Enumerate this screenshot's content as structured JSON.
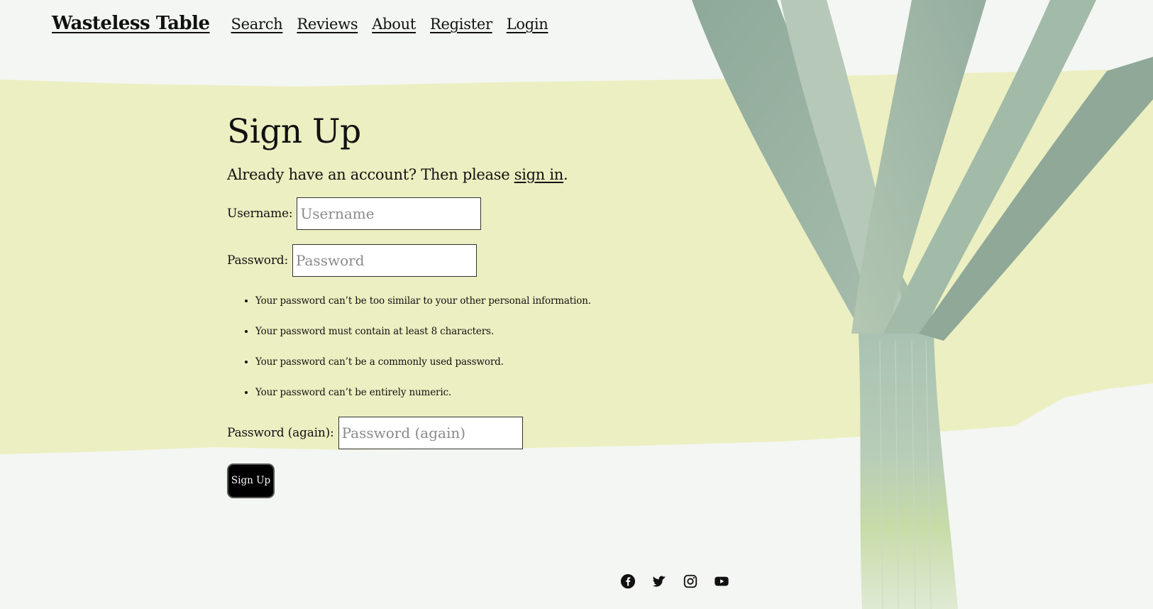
{
  "nav": {
    "brand": "Wasteless Table",
    "links": [
      "Search",
      "Reviews",
      "About",
      "Register",
      "Login"
    ]
  },
  "page": {
    "title": "Sign Up",
    "lead_prefix": "Already have an account? Then please ",
    "lead_link": "sign in",
    "lead_suffix": "."
  },
  "form": {
    "username_label": "Username:",
    "username_placeholder": "Username",
    "password_label": "Password:",
    "password_placeholder": "Password",
    "help": [
      "Your password can’t be too similar to your other personal information.",
      "Your password must contain at least 8 characters.",
      "Your password can’t be a commonly used password.",
      "Your password can’t be entirely numeric."
    ],
    "password2_label": "Password (again):",
    "password2_placeholder": "Password (again)",
    "submit_label": "Sign Up"
  },
  "footer": {
    "social_icons": [
      "facebook-icon",
      "twitter-icon",
      "instagram-icon",
      "youtube-icon"
    ]
  },
  "colors": {
    "paint_stroke": "#ecefc1",
    "leek_green": "#9fb5a6",
    "leek_stem": "#d7e7c3",
    "button_bg": "#000000"
  }
}
